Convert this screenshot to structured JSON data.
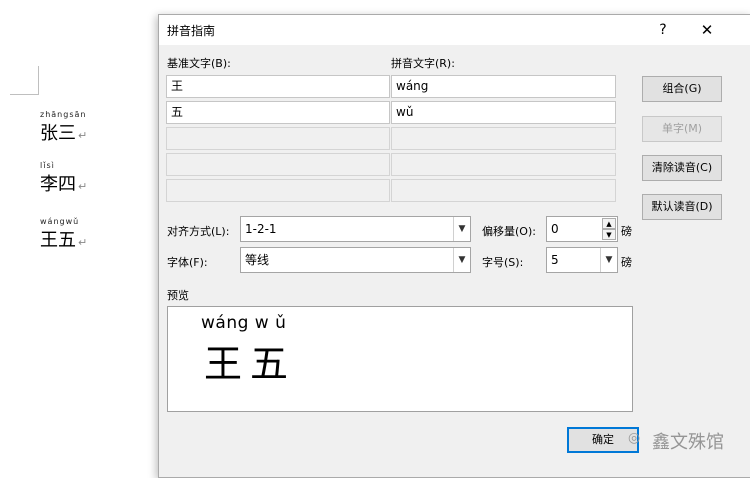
{
  "document": {
    "lines": [
      {
        "ruby": "zhāngsān",
        "base": "张三",
        "mark": "↵"
      },
      {
        "ruby": "lǐsì",
        "base": "李四",
        "mark": "↵"
      },
      {
        "ruby": "wángwǔ",
        "base": "王五",
        "mark": "↵"
      }
    ]
  },
  "dialog": {
    "title": "拼音指南",
    "help": "?",
    "close": "✕",
    "base_header": "基准文字(B):",
    "ruby_header": "拼音文字(R):",
    "rows": [
      {
        "base": "王",
        "ruby": "wáng"
      },
      {
        "base": "五",
        "ruby": "wǔ"
      },
      {
        "base": "",
        "ruby": ""
      },
      {
        "base": "",
        "ruby": ""
      },
      {
        "base": "",
        "ruby": ""
      }
    ],
    "buttons": {
      "group": "组合(G)",
      "mono": "单字(M)",
      "clear": "清除读音(C)",
      "default": "默认读音(D)",
      "ok": "确定"
    },
    "alignment_label": "对齐方式(L):",
    "alignment_value": "1-2-1",
    "offset_label": "偏移量(O):",
    "offset_value": "0",
    "offset_unit": "磅",
    "font_label": "字体(F):",
    "font_value": "等线",
    "size_label": "字号(S):",
    "size_value": "5",
    "size_unit": "磅",
    "preview_label": "预览",
    "preview_ruby": "wáng w ǔ",
    "preview_base": "王五"
  },
  "watermark": "鑫文殊馆"
}
